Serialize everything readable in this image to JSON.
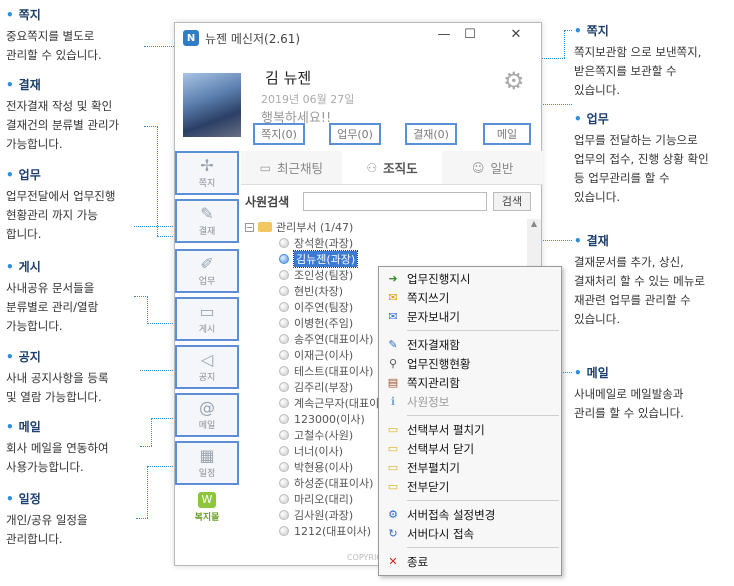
{
  "window": {
    "title": "뉴젠 메신저(2.61)",
    "app_icon": "N",
    "controls": {
      "minimize": "—",
      "maximize": "☐",
      "close": "✕"
    }
  },
  "profile": {
    "name": "김 뉴젠",
    "date": "2019년 06월 27일",
    "greeting": "행복하세요!!"
  },
  "quick_buttons": [
    "쪽지(0)",
    "업무(0)",
    "결재(0)",
    "메일"
  ],
  "left_nav": [
    {
      "label": "쪽지",
      "icon": "✢"
    },
    {
      "label": "결재",
      "icon": "✎"
    },
    {
      "label": "업무",
      "icon": "✐"
    },
    {
      "label": "게시",
      "icon": "▭"
    },
    {
      "label": "공지",
      "icon": "◁"
    },
    {
      "label": "메일",
      "icon": "@"
    },
    {
      "label": "일정",
      "icon": "▦"
    }
  ],
  "bokji": {
    "label": "복지몰",
    "icon": "W"
  },
  "tabs": [
    {
      "label": "최근채팅",
      "icon": "▭"
    },
    {
      "label": "조직도",
      "icon": "⚇"
    },
    {
      "label": "일반",
      "icon": "☺"
    }
  ],
  "search": {
    "label": "사원검색",
    "button": "검색"
  },
  "tree": {
    "root_label": "관리부서 (1/47)",
    "expander": "−",
    "members": [
      "장석환(과장)",
      "김뉴젠(과장)",
      "조인성(팀장)",
      "현빈(차장)",
      "이주연(팀장)",
      "이병헌(주임)",
      "송주연(대표이사)",
      "이재근(이사)",
      "테스트(대표이사)",
      "김주리(부장)",
      "계속근무자(대표이사)",
      "123000(이사)",
      "고철수(사원)",
      "너너(이사)",
      "박현용(이사)",
      "하성준(대표이사)",
      "마리오(대리)",
      "김사원(과장)",
      "1212(대표이사)"
    ],
    "selected_index": 1
  },
  "copyright": "COPYRIGHT",
  "context_menu": [
    {
      "label": "업무진행지시",
      "icon": "➜",
      "color": "#3a8d2f"
    },
    {
      "label": "쪽지쓰기",
      "icon": "✉",
      "color": "#d89a00"
    },
    {
      "label": "문자보내기",
      "icon": "✉",
      "color": "#2f6fc4"
    },
    {
      "sep": true
    },
    {
      "label": "전자결재함",
      "icon": "✎",
      "color": "#2f6fc4"
    },
    {
      "label": "업무진행현황",
      "icon": "⚲",
      "color": "#555555"
    },
    {
      "label": "쪽지관리함",
      "icon": "▤",
      "color": "#a0522d"
    },
    {
      "label": "사원정보",
      "icon": "ℹ",
      "color": "#7aa7d8",
      "disabled": true
    },
    {
      "sep": true
    },
    {
      "label": "선택부서 펼치기",
      "icon": "▭",
      "color": "#e0b020"
    },
    {
      "label": "선택부서 닫기",
      "icon": "▭",
      "color": "#e0b020"
    },
    {
      "label": "전부펼치기",
      "icon": "▭",
      "color": "#e0b020"
    },
    {
      "label": "전부닫기",
      "icon": "▭",
      "color": "#e0b020"
    },
    {
      "sep": true
    },
    {
      "label": "서버접속 설정변경",
      "icon": "⚙",
      "color": "#2f6fc4"
    },
    {
      "label": "서버다시 접속",
      "icon": "↻",
      "color": "#2f6fc4"
    },
    {
      "sep": true
    },
    {
      "label": "종료",
      "icon": "✕",
      "color": "#d62020"
    }
  ],
  "annotations_left": [
    {
      "title": "쪽지",
      "lines": [
        "중요쪽지를 별도로",
        "관리할 수 있습니다."
      ]
    },
    {
      "title": "결재",
      "lines": [
        "전자결재 작성 및 확인",
        "결재건의 분류별 관리가",
        "가능합니다."
      ]
    },
    {
      "title": "업무",
      "lines": [
        "업무전달에서 업무진행",
        "현황관리 까지 가능",
        "합니다."
      ]
    },
    {
      "title": "게시",
      "lines": [
        "사내공유 문서들을",
        "분류별로 관리/열람",
        "가능합니다."
      ]
    },
    {
      "title": "공지",
      "lines": [
        "사내 공지사항을 등록",
        "및 열람 가능합니다."
      ]
    },
    {
      "title": "메일",
      "lines": [
        "회사 메일을 연동하여",
        "사용가능합니다."
      ]
    },
    {
      "title": "일정",
      "lines": [
        "개인/공유 일정을",
        "관리합니다."
      ]
    }
  ],
  "annotations_right": [
    {
      "title": "쪽지",
      "lines": [
        "쪽지보관함 으로 보낸쪽지,",
        "받은쪽지를 보관할 수",
        "있습니다."
      ]
    },
    {
      "title": "업무",
      "lines": [
        "업무를 전달하는 기능으로",
        "업무의 접수, 진행 상황 확인",
        "등 업무관리를 할 수",
        "있습니다."
      ]
    },
    {
      "title": "결재",
      "lines": [
        "결재문서를 추가, 상신,",
        "결재처리 할 수 있는 메뉴로",
        "재관련 업무를 관리할 수",
        "있습니다."
      ]
    },
    {
      "title": "메일",
      "lines": [
        "사내메일로 메일발송과",
        "관리를 할 수 있습니다."
      ]
    }
  ]
}
